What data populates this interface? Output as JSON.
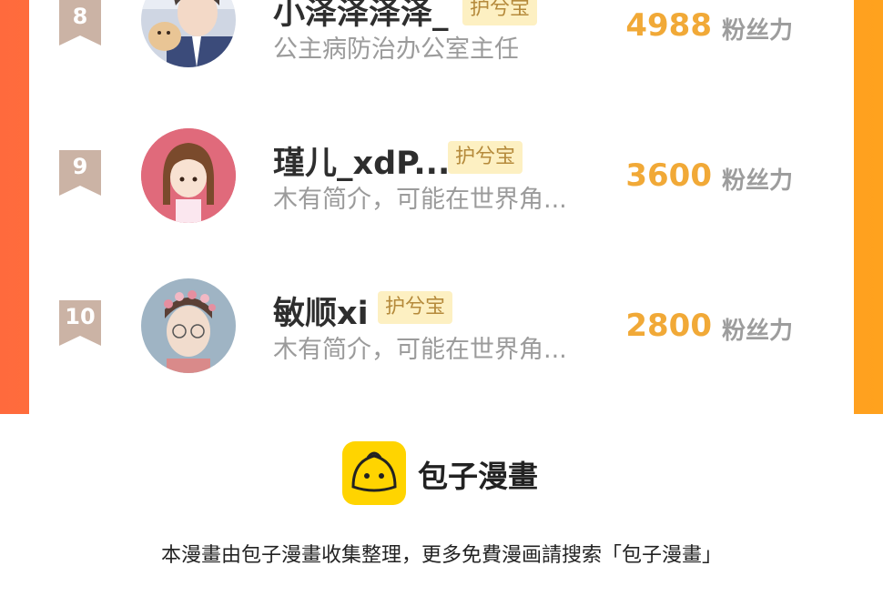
{
  "entries": [
    {
      "rank": "8",
      "name": "小泽泽泽泽_",
      "tag": "护兮宝",
      "bio": "公主病防治办公室主任",
      "score": "4988",
      "score_label": "粉丝力",
      "avatar_icon": "avatar-boy-with-dog-icon"
    },
    {
      "rank": "9",
      "name": "瑾儿_xdP...",
      "tag": "护兮宝",
      "bio": "木有简介，可能在世界角...",
      "score": "3600",
      "score_label": "粉丝力",
      "avatar_icon": "avatar-girl-braids-icon"
    },
    {
      "rank": "10",
      "name": "敏顺xi",
      "tag": "护兮宝",
      "bio": "木有简介，可能在世界角...",
      "score": "2800",
      "score_label": "粉丝力",
      "avatar_icon": "avatar-boy-flower-crown-icon"
    }
  ],
  "footer": {
    "brand_name": "包子漫畫",
    "notice": "本漫畫由包子漫畫收集整理，更多免費漫画請搜索「包子漫畫」",
    "logo_icon": "bun-logo-icon"
  },
  "colors": {
    "accent_orange": "#ff8a33",
    "score_gold": "#f1a937",
    "tag_bg": "#fdf0c2",
    "logo_yellow": "#ffd400"
  }
}
